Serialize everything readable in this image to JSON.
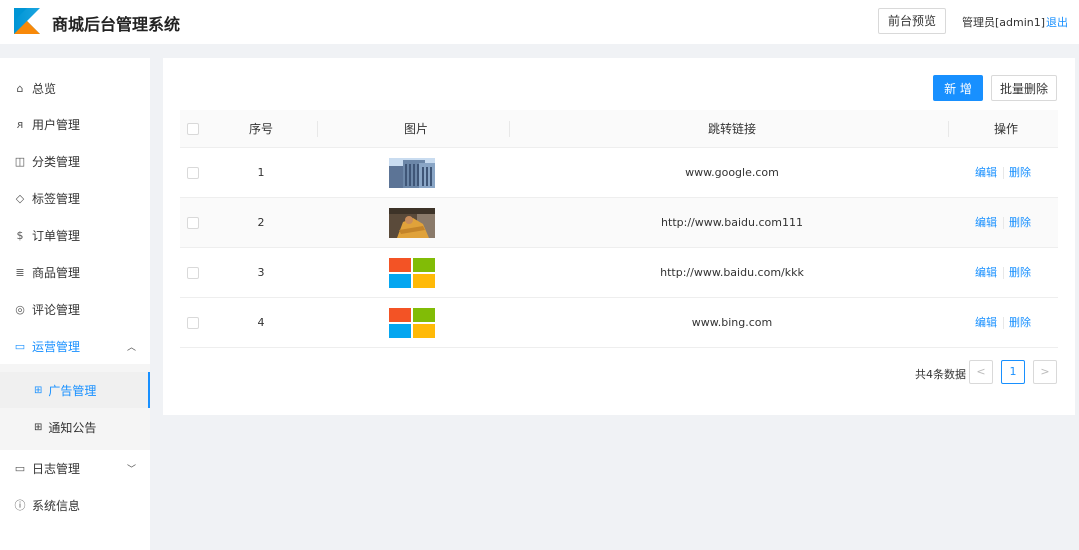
{
  "header": {
    "title": "商城后台管理系统",
    "preview_label": "前台预览",
    "admin_label": "管理员[admin1]",
    "logout_label": "退出",
    "brand_color": "#1890ff"
  },
  "sidebar": {
    "items": [
      {
        "label": "总览",
        "icon": "home-icon"
      },
      {
        "label": "用户管理",
        "icon": "user-icon"
      },
      {
        "label": "分类管理",
        "icon": "category-icon"
      },
      {
        "label": "标签管理",
        "icon": "tag-icon"
      },
      {
        "label": "订单管理",
        "icon": "order-icon"
      },
      {
        "label": "商品管理",
        "icon": "list-icon"
      },
      {
        "label": "评论管理",
        "icon": "comment-icon"
      },
      {
        "label": "运营管理",
        "icon": "folder-icon"
      },
      {
        "label": "日志管理",
        "icon": "folder-icon"
      },
      {
        "label": "系统信息",
        "icon": "info-icon"
      }
    ],
    "sub_items": [
      {
        "label": "广告管理",
        "icon": "grid-icon"
      },
      {
        "label": "通知公告",
        "icon": "grid-icon"
      }
    ]
  },
  "toolbar": {
    "add_label": "新 增",
    "batch_delete_label": "批量删除"
  },
  "table": {
    "columns": [
      "序号",
      "图片",
      "跳转链接",
      "操作"
    ],
    "rows": [
      {
        "index": "1",
        "image": "building-photo",
        "link": "www.google.com"
      },
      {
        "index": "2",
        "image": "person-photo",
        "link": "http://www.baidu.com111"
      },
      {
        "index": "3",
        "image": "windows-logo",
        "link": "http://www.baidu.com/kkk"
      },
      {
        "index": "4",
        "image": "windows-logo",
        "link": "www.bing.com"
      }
    ],
    "edit_label": "编辑",
    "delete_label": "删除"
  },
  "pagination": {
    "total_label": "共4条数据",
    "prev": "<",
    "current_page": "1",
    "next": ">"
  }
}
